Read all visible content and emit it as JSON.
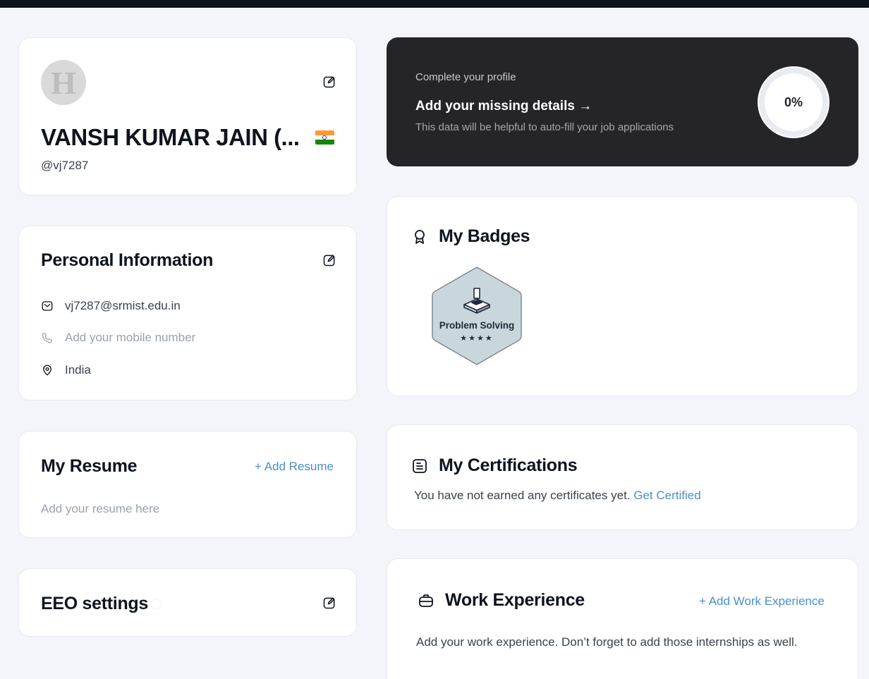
{
  "profile": {
    "avatar_letter": "H",
    "name": "VANSH KUMAR JAIN (...",
    "country_flag": "india-flag",
    "username": "@vj7287"
  },
  "personal_info": {
    "title": "Personal Information",
    "email": "vj7287@srmist.edu.in",
    "phone_placeholder": "Add your mobile number",
    "location": "India"
  },
  "resume": {
    "title": "My Resume",
    "add_label": "+ Add Resume",
    "placeholder": "Add your resume here"
  },
  "eeo": {
    "title": "EEO settings"
  },
  "complete_profile": {
    "small_text": "Complete your profile",
    "cta": "Add your missing details →",
    "subtitle": "This data will be helpful to auto-fill your job applications",
    "progress_percent": 0,
    "progress_label": "0%"
  },
  "badges": {
    "title": "My Badges",
    "items": [
      {
        "name": "Problem Solving",
        "stars": "★★★★",
        "star_count": 4
      }
    ]
  },
  "certifications": {
    "title": "My Certifications",
    "empty_text": "You have not earned any certificates yet.",
    "link_label": "Get Certified"
  },
  "work_experience": {
    "title": "Work Experience",
    "add_label": "+ Add Work Experience",
    "empty_text": "Add your work experience. Don’t forget to add those internships as well."
  },
  "colors": {
    "dark_card": "#242429",
    "link": "#4a90c8",
    "topbar": "#0e141e",
    "background": "#f3f5fa"
  }
}
